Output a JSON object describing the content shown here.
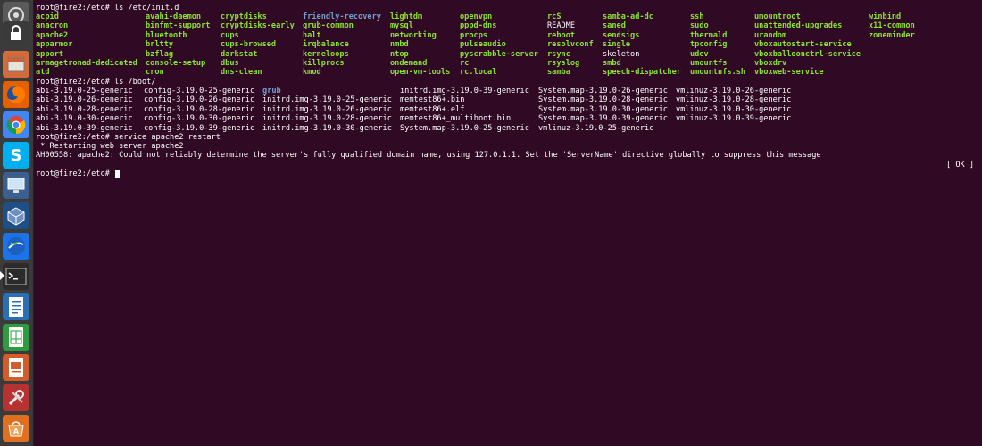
{
  "launcher": {
    "items": [
      {
        "name": "dash-home-icon",
        "color": "#5a5a5a"
      },
      {
        "name": "lock-icon",
        "color": "#3a3a3a"
      },
      {
        "name": "files-icon",
        "color": "#d46b3a"
      },
      {
        "name": "firefox-icon",
        "color": "#e66000"
      },
      {
        "name": "chrome-icon",
        "color": "#4285f4"
      },
      {
        "name": "skype-icon",
        "color": "#00aff0"
      },
      {
        "name": "remote-desktop-icon",
        "color": "#3b5f8f"
      },
      {
        "name": "virtualbox-icon",
        "color": "#1f4f87"
      },
      {
        "name": "google-earth-icon",
        "color": "#1a73e8"
      },
      {
        "name": "terminal-icon",
        "color": "#2c2c2c"
      },
      {
        "name": "writer-icon",
        "color": "#2a6fb5"
      },
      {
        "name": "calc-icon",
        "color": "#2e9b3f"
      },
      {
        "name": "impress-icon",
        "color": "#d35d2a"
      },
      {
        "name": "settings-icon",
        "color": "#b83232"
      },
      {
        "name": "software-center-icon",
        "color": "#e07020"
      }
    ]
  },
  "terminal": {
    "background": "#300a24",
    "colors": {
      "exec": "#8ae234",
      "dir": "#729fcf",
      "text": "#ffffff"
    },
    "init_d_columns": [
      [
        "acpid",
        "anacron",
        "apache2",
        "apparmor",
        "apport",
        "armagetronad-dedicated",
        "atd"
      ],
      [
        "avahi-daemon",
        "binfmt-support",
        "bluetooth",
        "brltty",
        "bzflag",
        "console-setup",
        "cron"
      ],
      [
        "cryptdisks",
        "cryptdisks-early",
        "cups",
        "cups-browsed",
        "darkstat",
        "dbus",
        "dns-clean"
      ],
      [
        "friendly-recovery",
        "grub-common",
        "halt",
        "irqbalance",
        "kerneloops",
        "killprocs",
        "kmod"
      ],
      [
        "lightdm",
        "mysql",
        "networking",
        "nmbd",
        "ntop",
        "ondemand",
        "open-vm-tools"
      ],
      [
        "openvpn",
        "pppd-dns",
        "procps",
        "pulseaudio",
        "pyscrabble-server",
        "rc",
        "rc.local"
      ],
      [
        "rcS",
        "README",
        "reboot",
        "resolvconf",
        "rsync",
        "rsyslog",
        "samba"
      ],
      [
        "samba-ad-dc",
        "saned",
        "sendsigs",
        "single",
        "skeleton",
        "smbd",
        "speech-dispatcher"
      ],
      [
        "ssh",
        "sudo",
        "thermald",
        "tpconfig",
        "udev",
        "umountfs",
        "umountnfs.sh"
      ],
      [
        "umountroot",
        "unattended-upgrades",
        "urandom",
        "vboxautostart-service",
        "vboxballoonctrl-service",
        "vboxdrv",
        "vboxweb-service"
      ],
      [
        "winbind",
        "x11-common",
        "zoneminder",
        "",
        "",
        "",
        ""
      ]
    ],
    "boot_columns": [
      [
        "abi-3.19.0-25-generic",
        "abi-3.19.0-26-generic",
        "abi-3.19.0-28-generic",
        "abi-3.19.0-30-generic",
        "abi-3.19.0-39-generic"
      ],
      [
        "config-3.19.0-25-generic",
        "config-3.19.0-26-generic",
        "config-3.19.0-28-generic",
        "config-3.19.0-30-generic",
        "config-3.19.0-39-generic"
      ],
      [
        "grub",
        "initrd.img-3.19.0-25-generic",
        "initrd.img-3.19.0-26-generic",
        "initrd.img-3.19.0-28-generic",
        "initrd.img-3.19.0-30-generic"
      ],
      [
        "initrd.img-3.19.0-39-generic",
        "memtest86+.bin",
        "memtest86+.elf",
        "memtest86+_multiboot.bin",
        "System.map-3.19.0-25-generic"
      ],
      [
        "System.map-3.19.0-26-generic",
        "System.map-3.19.0-28-generic",
        "System.map-3.19.0-30-generic",
        "System.map-3.19.0-39-generic",
        "vmlinuz-3.19.0-25-generic"
      ],
      [
        "vmlinuz-3.19.0-26-generic",
        "vmlinuz-3.19.0-28-generic",
        "vmlinuz-3.19.0-30-generic",
        "vmlinuz-3.19.0-39-generic",
        ""
      ]
    ],
    "lines": {
      "cmd1": "root@fire2:/etc# ls /etc/init.d",
      "cmd2": "root@fire2:/etc# ls /boot/",
      "cmd3": "root@fire2:/etc# service apache2 restart",
      "restart": " * Restarting web server apache2",
      "warning": "AH00558: apache2: Could not reliably determine the server's fully qualified domain name, using 127.0.1.1. Set the 'ServerName' directive globally to suppress this message",
      "ok": "[ OK ]",
      "prompt": "root@fire2:/etc# "
    }
  }
}
